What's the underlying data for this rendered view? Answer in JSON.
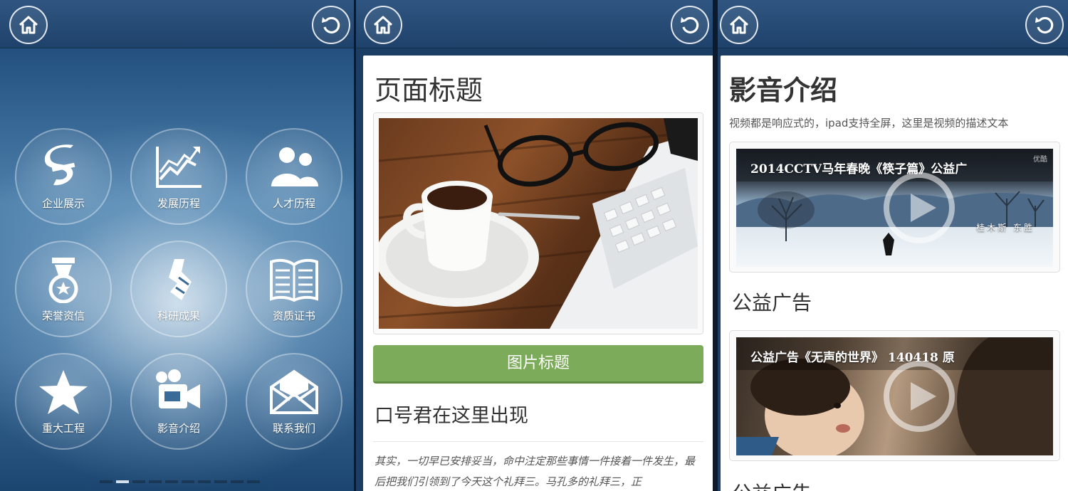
{
  "screen_1": {
    "tiles": [
      {
        "label": "企业展示",
        "icon": "company-logo-icon"
      },
      {
        "label": "发展历程",
        "icon": "growth-chart-icon"
      },
      {
        "label": "人才历程",
        "icon": "people-icon"
      },
      {
        "label": "荣誉资信",
        "icon": "medal-icon"
      },
      {
        "label": "科研成果",
        "icon": "research-icon"
      },
      {
        "label": "资质证书",
        "icon": "book-icon"
      },
      {
        "label": "重大工程",
        "icon": "star-icon"
      },
      {
        "label": "影音介绍",
        "icon": "video-camera-icon"
      },
      {
        "label": "联系我们",
        "icon": "envelope-icon"
      }
    ],
    "pager_active_index": 1
  },
  "screen_2": {
    "page_title": "页面标题",
    "image_button_label": "图片标题",
    "slogan": "口号君在这里出现",
    "paragraph": "其实，一切早已安排妥当，命中注定那些事情一件接着一件发生，最后把我们引领到了今天这个礼拜三。马孔多的礼拜三，正"
  },
  "screen_3": {
    "title": "影音介绍",
    "description": "视频都是响应式的，ipad支持全屏，这里是视频的描述文本",
    "video_1": {
      "title": "2014CCTV马年春晚《筷子篇》公益广",
      "badge": "优酷",
      "caption": "桂木斯 东胜"
    },
    "section_1": "公益广告",
    "video_2": {
      "title": "公益广告《无声的世界》 140418 原"
    },
    "section_2": "公益广告"
  },
  "colors": {
    "topbar": "#2a4d77",
    "green_button": "#7cab5a",
    "card_background": "#ffffff",
    "text_dark": "#333333"
  }
}
